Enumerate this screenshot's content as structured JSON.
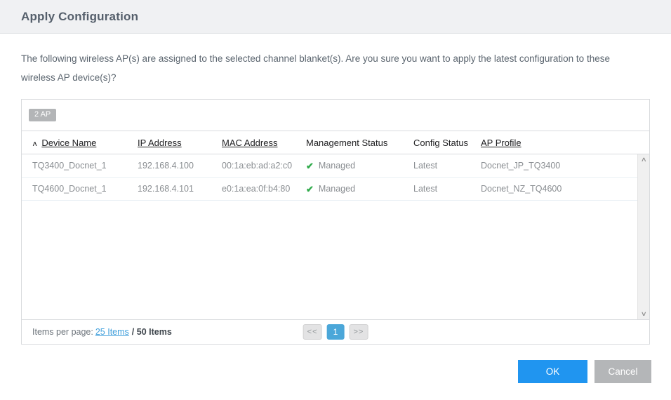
{
  "dialog": {
    "title": "Apply Configuration",
    "description": "The following wireless AP(s) are assigned to the selected channel blanket(s). Are you sure you want to apply the latest configuration to these wireless AP device(s)?"
  },
  "table": {
    "count_badge": "2 AP",
    "columns": [
      {
        "label": "Device Name",
        "sortable": true,
        "sorted": "asc"
      },
      {
        "label": "IP Address",
        "sortable": true
      },
      {
        "label": "MAC Address",
        "sortable": true
      },
      {
        "label": "Management Status",
        "sortable": false
      },
      {
        "label": "Config Status",
        "sortable": false
      },
      {
        "label": "AP Profile",
        "sortable": true
      }
    ],
    "rows": [
      {
        "device_name": "TQ3400_Docnet_1",
        "ip_address": "192.168.4.100",
        "mac_address": "00:1a:eb:ad:a2:c0",
        "management_status": "Managed",
        "config_status": "Latest",
        "ap_profile": "Docnet_JP_TQ3400"
      },
      {
        "device_name": "TQ4600_Docnet_1",
        "ip_address": "192.168.4.101",
        "mac_address": "e0:1a:ea:0f:b4:80",
        "management_status": "Managed",
        "config_status": "Latest",
        "ap_profile": "Docnet_NZ_TQ4600"
      }
    ]
  },
  "icons": {
    "sort_asc": "∧",
    "check": "✔",
    "scroll_up": "∧",
    "scroll_down": "∨"
  },
  "pagination": {
    "items_per_page_label": "Items per page:",
    "items_per_page_link": "25 Items",
    "total_label": "/ 50 Items",
    "prev_label": "<<",
    "current_page": "1",
    "next_label": ">>"
  },
  "footer": {
    "ok_label": "OK",
    "cancel_label": "Cancel"
  },
  "colors": {
    "accent_blue": "#2095f0",
    "page_active_blue": "#4ba7d9",
    "check_green": "#2faa4a",
    "link_blue": "#42a0dc",
    "header_bg": "#f0f1f3",
    "badge_gray": "#b3b5b7",
    "cancel_gray": "#b4b6b8"
  }
}
